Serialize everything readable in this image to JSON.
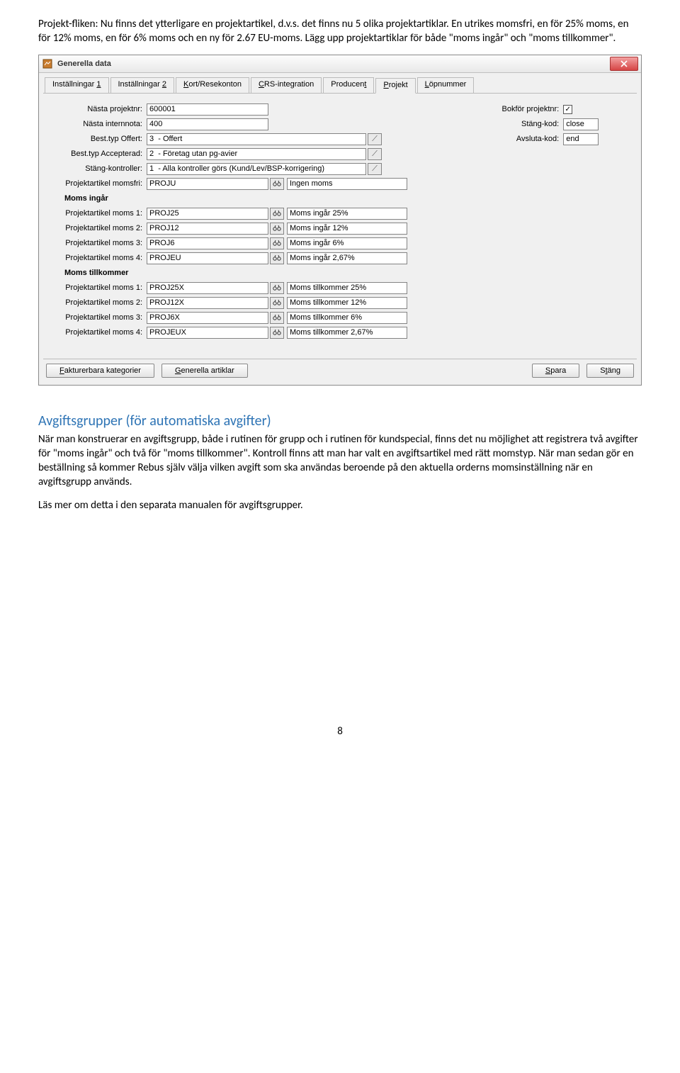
{
  "intro_paragraph": "Projekt-fliken: Nu finns det ytterligare en projektartikel, d.v.s. det finns nu 5 olika projektartiklar. En utrikes momsfri, en för 25% moms, en för 12% moms, en för 6% moms och en ny för 2.67 EU-moms. Lägg upp projektartiklar för både \"moms ingår\" och \"moms tillkommer\".",
  "window": {
    "title": "Generella data",
    "tabs": [
      "Inställningar 1",
      "Inställningar 2",
      "Kort/Resekonton",
      "CRS-integration",
      "Producent",
      "Projekt",
      "Löpnummer"
    ],
    "active_tab_index": 5,
    "left": {
      "rows": [
        {
          "label": "Nästa projektnr:",
          "value": "600001",
          "type": "short"
        },
        {
          "label": "Nästa internnota:",
          "value": "400",
          "type": "short"
        },
        {
          "label": "Best.typ Offert:",
          "value": "3  - Offert",
          "type": "lookup"
        },
        {
          "label": "Best.typ Accepterad:",
          "value": "2  - Företag utan pg-avier",
          "type": "lookup"
        },
        {
          "label": "Stäng-kontroller:",
          "value": "1  - Alla kontroller görs (Kund/Lev/BSP-korrigering)",
          "type": "lookup"
        },
        {
          "label": "Projektartikel momsfri:",
          "value": "PROJU",
          "desc": "Ingen moms",
          "type": "bino"
        }
      ],
      "section1_header": "Moms ingår",
      "section1": [
        {
          "label": "Projektartikel moms 1:",
          "value": "PROJ25",
          "desc": "Moms ingår 25%"
        },
        {
          "label": "Projektartikel moms 2:",
          "value": "PROJ12",
          "desc": "Moms ingår 12%"
        },
        {
          "label": "Projektartikel moms 3:",
          "value": "PROJ6",
          "desc": "Moms ingår 6%"
        },
        {
          "label": "Projektartikel moms 4:",
          "value": "PROJEU",
          "desc": "Moms ingår 2,67%"
        }
      ],
      "section2_header": "Moms tillkommer",
      "section2": [
        {
          "label": "Projektartikel moms 1:",
          "value": "PROJ25X",
          "desc": "Moms tillkommer 25%"
        },
        {
          "label": "Projektartikel moms 2:",
          "value": "PROJ12X",
          "desc": "Moms tillkommer 12%"
        },
        {
          "label": "Projektartikel moms 3:",
          "value": "PROJ6X",
          "desc": "Moms tillkommer 6%"
        },
        {
          "label": "Projektartikel moms 4:",
          "value": "PROJEUX",
          "desc": "Moms tillkommer 2,67%"
        }
      ]
    },
    "right": [
      {
        "label": "Bokför projektnr:",
        "type": "check",
        "checked": true
      },
      {
        "label": "Stäng-kod:",
        "type": "text",
        "value": "close"
      },
      {
        "label": "Avsluta-kod:",
        "type": "text",
        "value": "end"
      }
    ],
    "buttons": {
      "fakturerbara": "Fakturerbara kategorier",
      "generella": "Generella artiklar",
      "spara": "Spara",
      "stang": "Stäng"
    }
  },
  "heading_avgift": "Avgiftsgrupper (för automatiska avgifter)",
  "avgift_paragraph": "När man konstruerar en avgiftsgrupp, både i rutinen för grupp och i rutinen för kundspecial, finns det nu möjlighet att registrera två avgifter för \"moms ingår\" och två för \"moms tillkommer\". Kontroll finns att man har valt en avgiftsartikel med rätt momstyp. När man sedan gör en beställning så kommer Rebus själv välja vilken avgift som ska användas beroende på den aktuella orderns momsinställning när en avgiftsgrupp används.",
  "avgift_paragraph2": "Läs mer om detta i den separata manualen för avgiftsgrupper.",
  "page_number": "8"
}
